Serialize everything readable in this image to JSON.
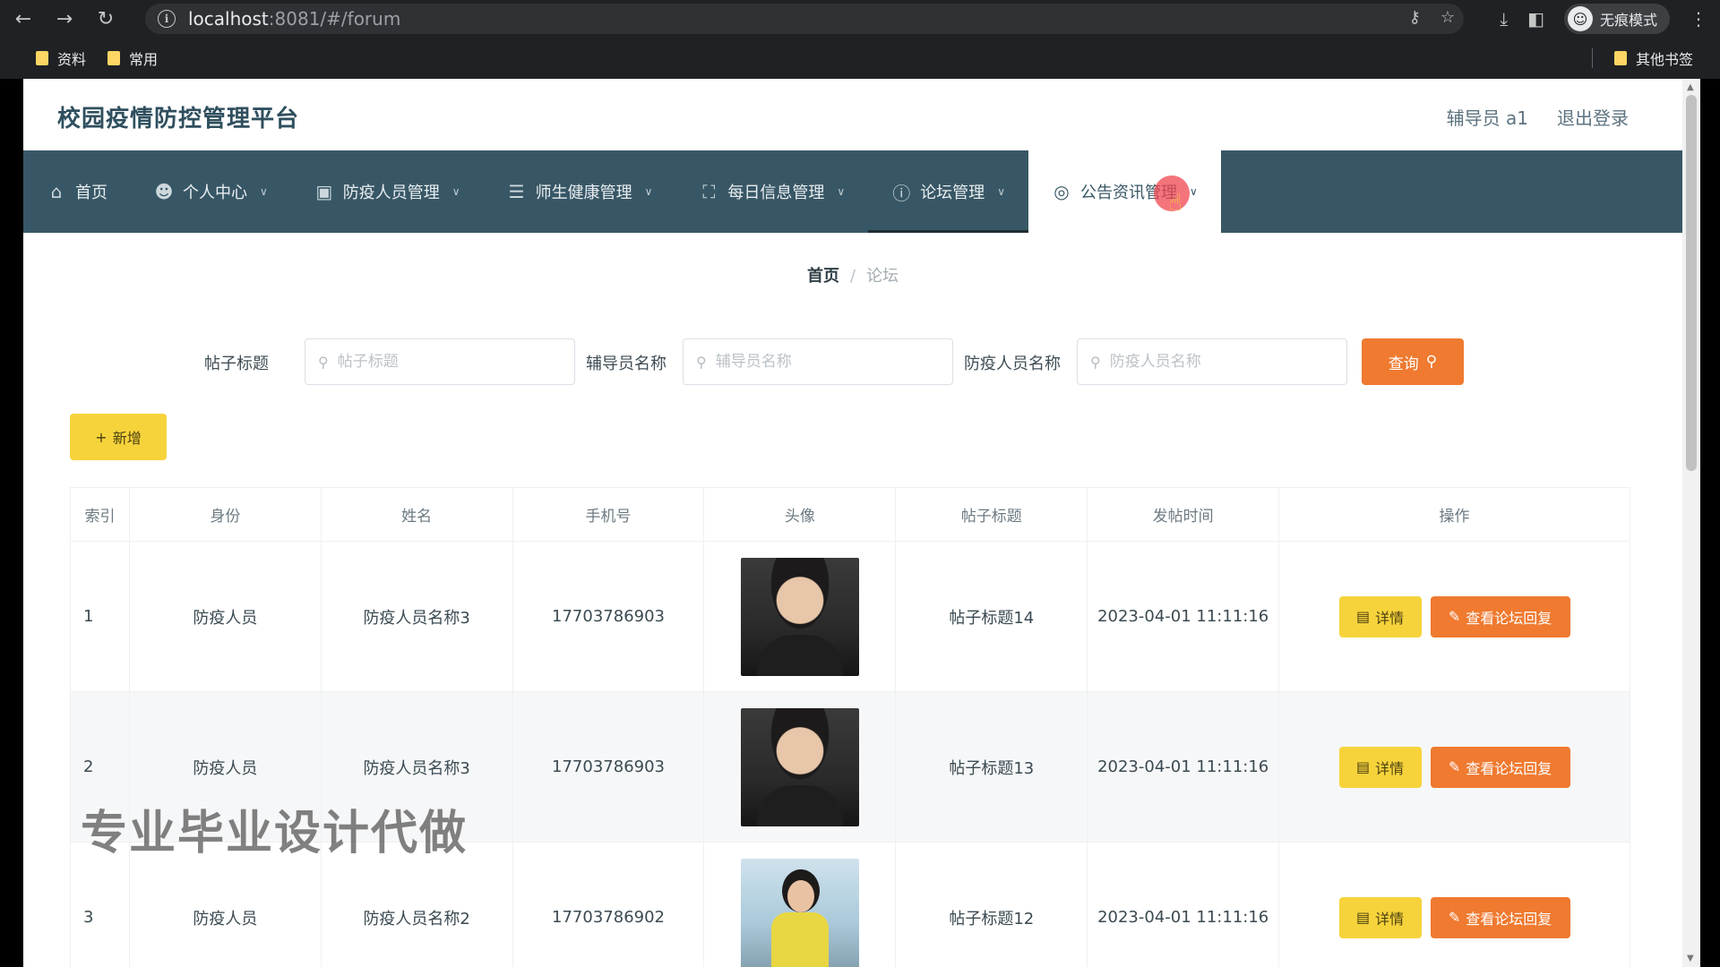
{
  "browser": {
    "url_host": "localhost",
    "url_rest": ":8081/#/forum",
    "incognito_label": "无痕模式",
    "bookmarks": [
      "资料",
      "常用"
    ],
    "other_bookmarks": "其他书签"
  },
  "header": {
    "title": "校园疫情防控管理平台",
    "user": "辅导员 a1",
    "logout": "退出登录"
  },
  "menu": [
    {
      "label": "首页",
      "icon": "home-icon"
    },
    {
      "label": "个人中心",
      "icon": "user-icon"
    },
    {
      "label": "防疫人员管理",
      "icon": "briefcase-icon"
    },
    {
      "label": "师生健康管理",
      "icon": "list-icon"
    },
    {
      "label": "每日信息管理",
      "icon": "frame-icon"
    },
    {
      "label": "论坛管理",
      "icon": "info-icon"
    },
    {
      "label": "公告资讯管理",
      "icon": "target-icon"
    }
  ],
  "breadcrumb": {
    "home": "首页",
    "current": "论坛"
  },
  "search": {
    "title_label": "帖子标题",
    "title_placeholder": "帖子标题",
    "counselor_label": "辅导员名称",
    "counselor_placeholder": "辅导员名称",
    "staff_label": "防疫人员名称",
    "staff_placeholder": "防疫人员名称",
    "query_label": "查询"
  },
  "add_label": "新增",
  "table": {
    "headers": [
      "索引",
      "身份",
      "姓名",
      "手机号",
      "头像",
      "帖子标题",
      "发帖时间",
      "操作"
    ],
    "rows": [
      {
        "index": "1",
        "role": "防疫人员",
        "name": "防疫人员名称3",
        "phone": "17703786903",
        "avatar": "male",
        "title": "帖子标题14",
        "time": "2023-04-01 11:11:16"
      },
      {
        "index": "2",
        "role": "防疫人员",
        "name": "防疫人员名称3",
        "phone": "17703786903",
        "avatar": "male",
        "title": "帖子标题13",
        "time": "2023-04-01 11:11:16"
      },
      {
        "index": "3",
        "role": "防疫人员",
        "name": "防疫人员名称2",
        "phone": "17703786902",
        "avatar": "female",
        "title": "帖子标题12",
        "time": "2023-04-01 11:11:16"
      }
    ],
    "detail_label": "详情",
    "reply_label": "查看论坛回复"
  },
  "watermark": "专业毕业设计代做",
  "colors": {
    "menu_bg": "#385766",
    "accent_orange": "#ef7a30",
    "accent_yellow": "#f7d33b"
  }
}
